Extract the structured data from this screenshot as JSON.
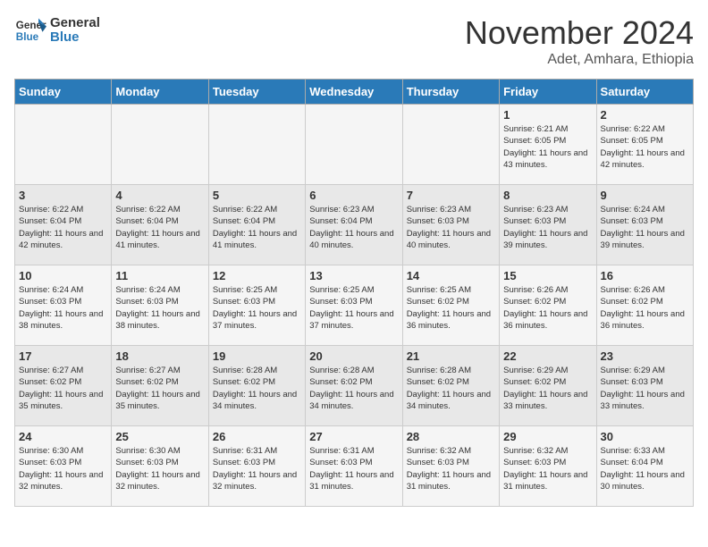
{
  "header": {
    "logo_line1": "General",
    "logo_line2": "Blue",
    "month_title": "November 2024",
    "location": "Adet, Amhara, Ethiopia"
  },
  "weekdays": [
    "Sunday",
    "Monday",
    "Tuesday",
    "Wednesday",
    "Thursday",
    "Friday",
    "Saturday"
  ],
  "weeks": [
    [
      {
        "day": "",
        "info": ""
      },
      {
        "day": "",
        "info": ""
      },
      {
        "day": "",
        "info": ""
      },
      {
        "day": "",
        "info": ""
      },
      {
        "day": "",
        "info": ""
      },
      {
        "day": "1",
        "info": "Sunrise: 6:21 AM\nSunset: 6:05 PM\nDaylight: 11 hours and 43 minutes."
      },
      {
        "day": "2",
        "info": "Sunrise: 6:22 AM\nSunset: 6:05 PM\nDaylight: 11 hours and 42 minutes."
      }
    ],
    [
      {
        "day": "3",
        "info": "Sunrise: 6:22 AM\nSunset: 6:04 PM\nDaylight: 11 hours and 42 minutes."
      },
      {
        "day": "4",
        "info": "Sunrise: 6:22 AM\nSunset: 6:04 PM\nDaylight: 11 hours and 41 minutes."
      },
      {
        "day": "5",
        "info": "Sunrise: 6:22 AM\nSunset: 6:04 PM\nDaylight: 11 hours and 41 minutes."
      },
      {
        "day": "6",
        "info": "Sunrise: 6:23 AM\nSunset: 6:04 PM\nDaylight: 11 hours and 40 minutes."
      },
      {
        "day": "7",
        "info": "Sunrise: 6:23 AM\nSunset: 6:03 PM\nDaylight: 11 hours and 40 minutes."
      },
      {
        "day": "8",
        "info": "Sunrise: 6:23 AM\nSunset: 6:03 PM\nDaylight: 11 hours and 39 minutes."
      },
      {
        "day": "9",
        "info": "Sunrise: 6:24 AM\nSunset: 6:03 PM\nDaylight: 11 hours and 39 minutes."
      }
    ],
    [
      {
        "day": "10",
        "info": "Sunrise: 6:24 AM\nSunset: 6:03 PM\nDaylight: 11 hours and 38 minutes."
      },
      {
        "day": "11",
        "info": "Sunrise: 6:24 AM\nSunset: 6:03 PM\nDaylight: 11 hours and 38 minutes."
      },
      {
        "day": "12",
        "info": "Sunrise: 6:25 AM\nSunset: 6:03 PM\nDaylight: 11 hours and 37 minutes."
      },
      {
        "day": "13",
        "info": "Sunrise: 6:25 AM\nSunset: 6:03 PM\nDaylight: 11 hours and 37 minutes."
      },
      {
        "day": "14",
        "info": "Sunrise: 6:25 AM\nSunset: 6:02 PM\nDaylight: 11 hours and 36 minutes."
      },
      {
        "day": "15",
        "info": "Sunrise: 6:26 AM\nSunset: 6:02 PM\nDaylight: 11 hours and 36 minutes."
      },
      {
        "day": "16",
        "info": "Sunrise: 6:26 AM\nSunset: 6:02 PM\nDaylight: 11 hours and 36 minutes."
      }
    ],
    [
      {
        "day": "17",
        "info": "Sunrise: 6:27 AM\nSunset: 6:02 PM\nDaylight: 11 hours and 35 minutes."
      },
      {
        "day": "18",
        "info": "Sunrise: 6:27 AM\nSunset: 6:02 PM\nDaylight: 11 hours and 35 minutes."
      },
      {
        "day": "19",
        "info": "Sunrise: 6:28 AM\nSunset: 6:02 PM\nDaylight: 11 hours and 34 minutes."
      },
      {
        "day": "20",
        "info": "Sunrise: 6:28 AM\nSunset: 6:02 PM\nDaylight: 11 hours and 34 minutes."
      },
      {
        "day": "21",
        "info": "Sunrise: 6:28 AM\nSunset: 6:02 PM\nDaylight: 11 hours and 34 minutes."
      },
      {
        "day": "22",
        "info": "Sunrise: 6:29 AM\nSunset: 6:02 PM\nDaylight: 11 hours and 33 minutes."
      },
      {
        "day": "23",
        "info": "Sunrise: 6:29 AM\nSunset: 6:03 PM\nDaylight: 11 hours and 33 minutes."
      }
    ],
    [
      {
        "day": "24",
        "info": "Sunrise: 6:30 AM\nSunset: 6:03 PM\nDaylight: 11 hours and 32 minutes."
      },
      {
        "day": "25",
        "info": "Sunrise: 6:30 AM\nSunset: 6:03 PM\nDaylight: 11 hours and 32 minutes."
      },
      {
        "day": "26",
        "info": "Sunrise: 6:31 AM\nSunset: 6:03 PM\nDaylight: 11 hours and 32 minutes."
      },
      {
        "day": "27",
        "info": "Sunrise: 6:31 AM\nSunset: 6:03 PM\nDaylight: 11 hours and 31 minutes."
      },
      {
        "day": "28",
        "info": "Sunrise: 6:32 AM\nSunset: 6:03 PM\nDaylight: 11 hours and 31 minutes."
      },
      {
        "day": "29",
        "info": "Sunrise: 6:32 AM\nSunset: 6:03 PM\nDaylight: 11 hours and 31 minutes."
      },
      {
        "day": "30",
        "info": "Sunrise: 6:33 AM\nSunset: 6:04 PM\nDaylight: 11 hours and 30 minutes."
      }
    ]
  ]
}
